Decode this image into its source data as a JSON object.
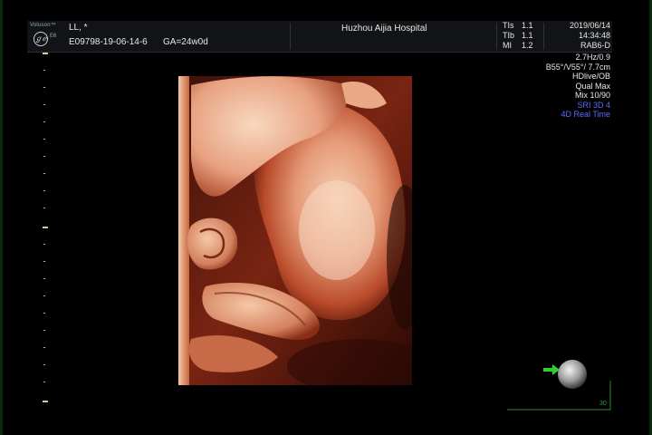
{
  "header": {
    "logo_brand": "Voluson™",
    "logo_model": "E6",
    "patient_name": "LL,  *",
    "exam_id": "E09798-19-06-14-6",
    "gestational_age": "GA=24w0d",
    "hospital": "Huzhou Aijia Hospital",
    "tis_label": "TIs",
    "tis_value": "1.1",
    "tib_label": "TIb",
    "tib_value": "1.1",
    "mi_label": "MI",
    "mi_value": "1.2",
    "date": "2019/06/14",
    "time": "14:34:48",
    "probe": "RAB6-D"
  },
  "info": {
    "frequency": "2.7Hz/0.9",
    "angles": "B55°/V55°/ 7.7cm",
    "mode": "HDlive/OB",
    "quality": "Qual Max",
    "mix": "Mix 10/90",
    "sri": "SRI 3D 4",
    "realtime": "4D Real Time"
  },
  "corner": {
    "label": "30"
  },
  "colors": {
    "header_bg": "#111316",
    "accent_blue": "#5a6bff",
    "skin_light": "#f3c2a2",
    "skin_dark": "#a8381c",
    "orientation_green": "#2fd02f"
  }
}
